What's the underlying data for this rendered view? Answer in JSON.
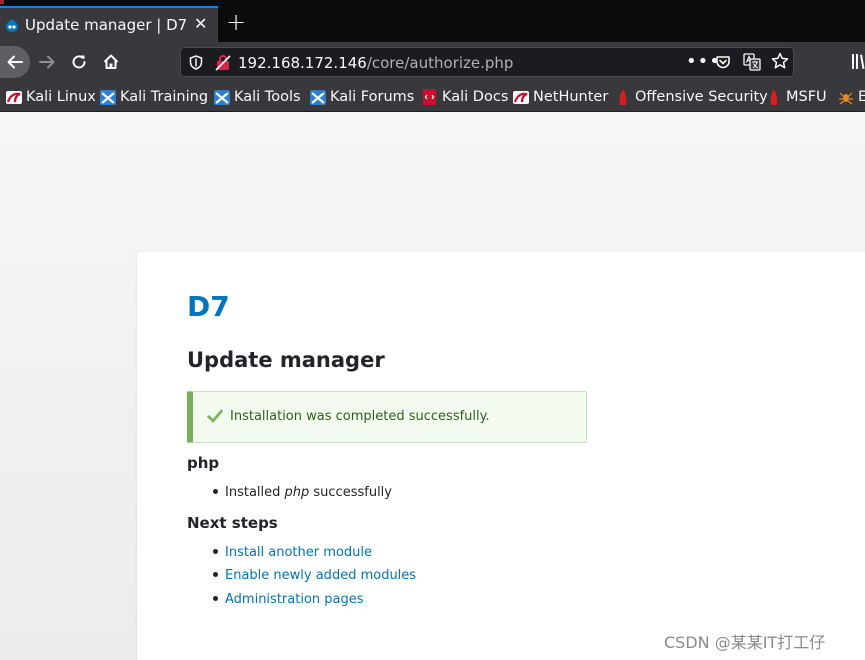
{
  "browser": {
    "tab_title": "Update manager | D7",
    "tab_close": "✕",
    "new_tab": "+",
    "url_host": "192.168.172.146",
    "url_path": "/core/authorize.php",
    "more": "•••"
  },
  "bookmarks": [
    {
      "label": "Kali Linux",
      "icon": "kali-red-icon"
    },
    {
      "label": "Kali Training",
      "icon": "kali-blue-icon"
    },
    {
      "label": "Kali Tools",
      "icon": "kali-blue-icon"
    },
    {
      "label": "Kali Forums",
      "icon": "kali-blue-icon"
    },
    {
      "label": "Kali Docs",
      "icon": "kali-docs-icon"
    },
    {
      "label": "NetHunter",
      "icon": "kali-red-icon"
    },
    {
      "label": "Offensive Security",
      "icon": "offsec-icon"
    },
    {
      "label": "MSFU",
      "icon": "offsec-icon"
    },
    {
      "label": "E",
      "icon": "exploitdb-icon"
    }
  ],
  "page": {
    "site_name": "D7",
    "title": "Update manager",
    "status_message": "Installation was completed successfully.",
    "php_heading": "php",
    "php_item_prefix": "Installed ",
    "php_item_name": "php",
    "php_item_suffix": " successfully",
    "next_steps_heading": "Next steps",
    "next_steps": [
      {
        "label": "Install another module"
      },
      {
        "label": "Enable newly added modules"
      },
      {
        "label": "Administration pages"
      }
    ]
  },
  "watermark": "CSDN @某某IT打工仔",
  "colors": {
    "link": "#0074bd",
    "status_accent": "#77b259",
    "status_bg": "#f3faef",
    "browser_chrome": "#38383d"
  }
}
